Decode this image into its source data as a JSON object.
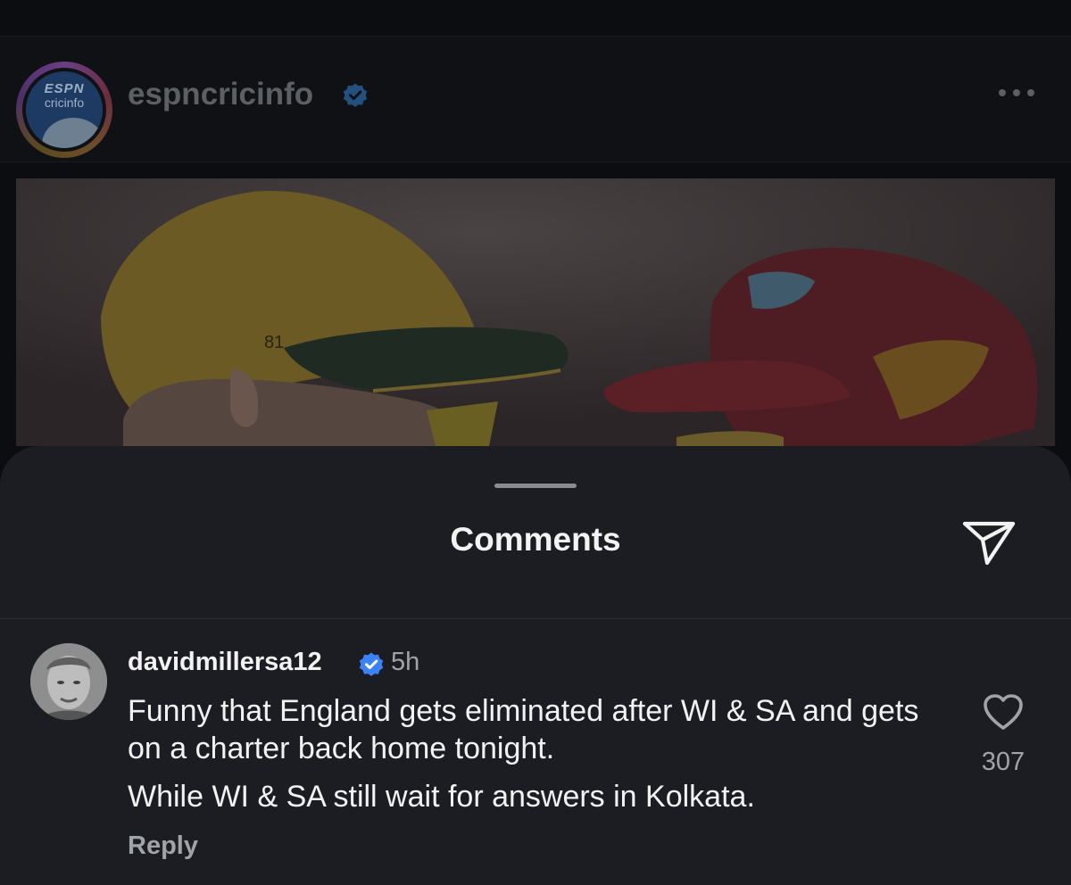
{
  "post": {
    "account_name": "espncricinfo",
    "avatar_logo_top": "ESPN",
    "avatar_logo_bottom": "cricinfo",
    "more_icon": "more-horizontal-icon",
    "verified_icon": "verified-badge-icon"
  },
  "comments_sheet": {
    "title": "Comments",
    "send_icon": "send-icon",
    "comments": [
      {
        "username": "davidmillersa12",
        "verified": true,
        "time": "5h",
        "text_line1": "Funny that England gets eliminated after WI & SA and gets on a charter back home tonight.",
        "text_line2": "While WI & SA still wait for answers in Kolkata.",
        "reply_label": "Reply",
        "like_icon": "heart-icon",
        "like_count": "307"
      }
    ]
  },
  "colors": {
    "background": "#0c0d10",
    "sheet": "#1b1d22",
    "verified_blue": "#3b82f6",
    "secondary_text": "#a0a3a8",
    "primary_text": "#f2f2f2"
  }
}
